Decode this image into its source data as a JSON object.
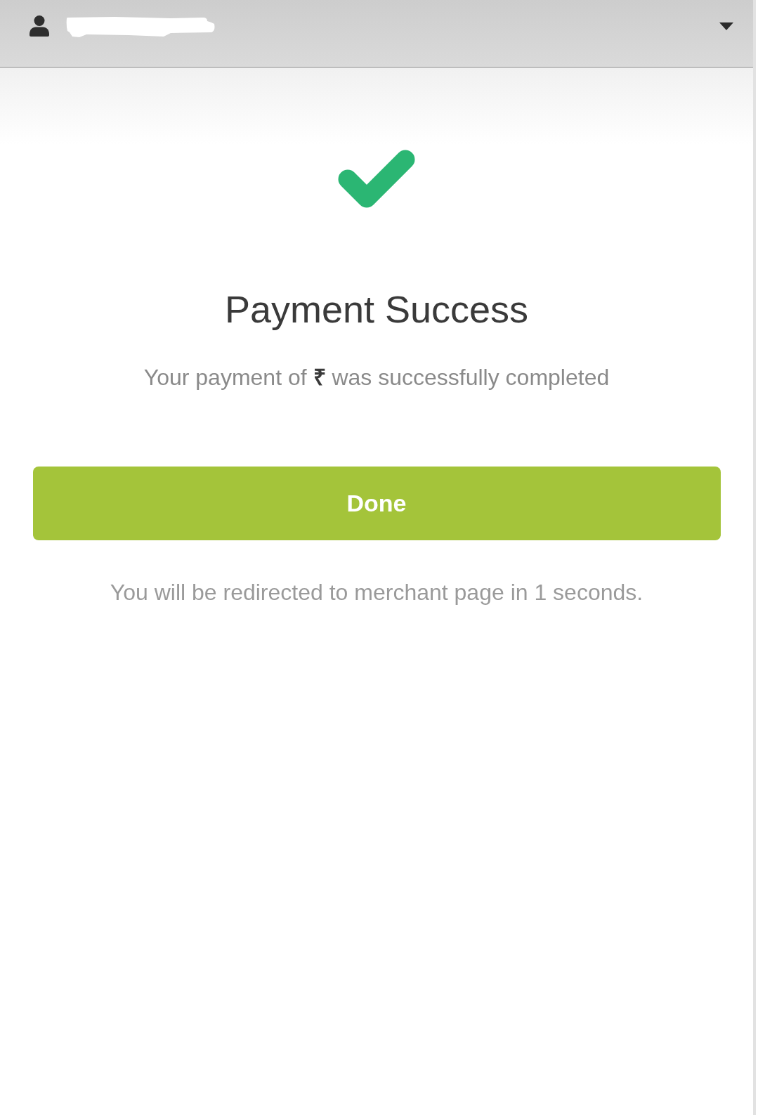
{
  "status": {
    "kind": "success",
    "title": "Payment Success",
    "message": "Your payment of **₹** was successfully completed"
  },
  "actions": [
    {
      "label": "Done",
      "kind": "primary"
    }
  ],
  "redirect_notice": "You will be redirected to merchant page in 1 seconds."
}
